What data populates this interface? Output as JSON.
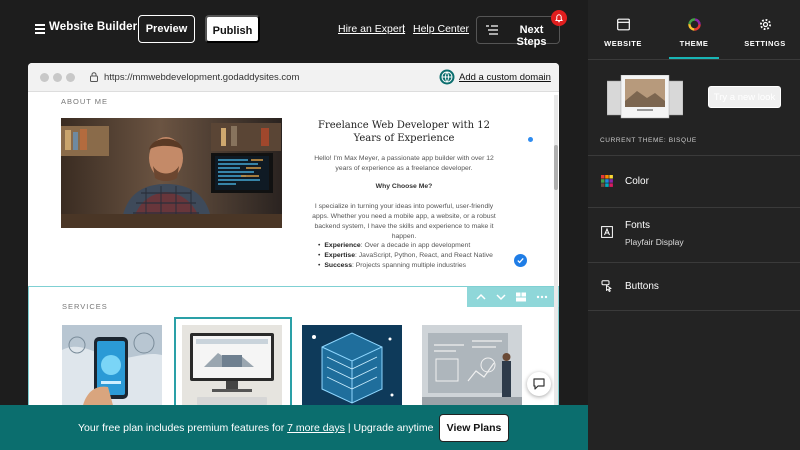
{
  "topbar": {
    "brand": "Website Builder",
    "preview": "Preview",
    "publish": "Publish",
    "hire": "Hire an Expert",
    "separator": "|",
    "help": "Help Center",
    "next_steps": "Next Steps"
  },
  "browser": {
    "url": "https://mmwebdevelopment.godaddysites.com",
    "custom_domain": "Add a custom domain"
  },
  "about": {
    "section_title": "ABOUT ME",
    "headline": "Freelance Web Developer with 12 Years of Experience",
    "intro": "Hello! I'm Max Meyer, a passionate app builder with over 12 years of experience as a freelance developer.",
    "why_title": "Why Choose Me?",
    "body": "I specialize in turning your ideas into powerful, user-friendly apps. Whether you need a mobile app, a website, or a robust backend system, I have the skills and experience to make it happen.",
    "bullets": [
      {
        "label": "Experience",
        "text": ": Over a decade in app development"
      },
      {
        "label": "Expertise",
        "text": ": JavaScript, Python, React, and React Native"
      },
      {
        "label": "Success",
        "text": ": Projects spanning multiple industries"
      }
    ]
  },
  "services": {
    "section_title": "SERVICES"
  },
  "banner": {
    "text_before": "Your free plan includes premium features for",
    "days": "7 more days",
    "text_after": "| Upgrade anytime",
    "view_plans": "View Plans"
  },
  "panel": {
    "tabs": [
      {
        "label": "WEBSITE",
        "icon": "browser-window-icon"
      },
      {
        "label": "THEME",
        "icon": "color-wheel-icon"
      },
      {
        "label": "SETTINGS",
        "icon": "gear-icon"
      }
    ],
    "active_tab": "THEME",
    "try_new_look": "Try a new look",
    "current_theme": "CURRENT THEME: BISQUE",
    "rows": [
      {
        "label": "Color",
        "sub": "",
        "icon": "color-palette-icon"
      },
      {
        "label": "Fonts",
        "sub": "Playfair Display",
        "icon": "font-icon"
      },
      {
        "label": "Buttons",
        "sub": "",
        "icon": "buttons-icon"
      }
    ]
  },
  "colors": {
    "accent": "#19b5b5",
    "banner": "#0b6e6e",
    "badge": "#e01e1e",
    "panel_bg": "#232323"
  }
}
